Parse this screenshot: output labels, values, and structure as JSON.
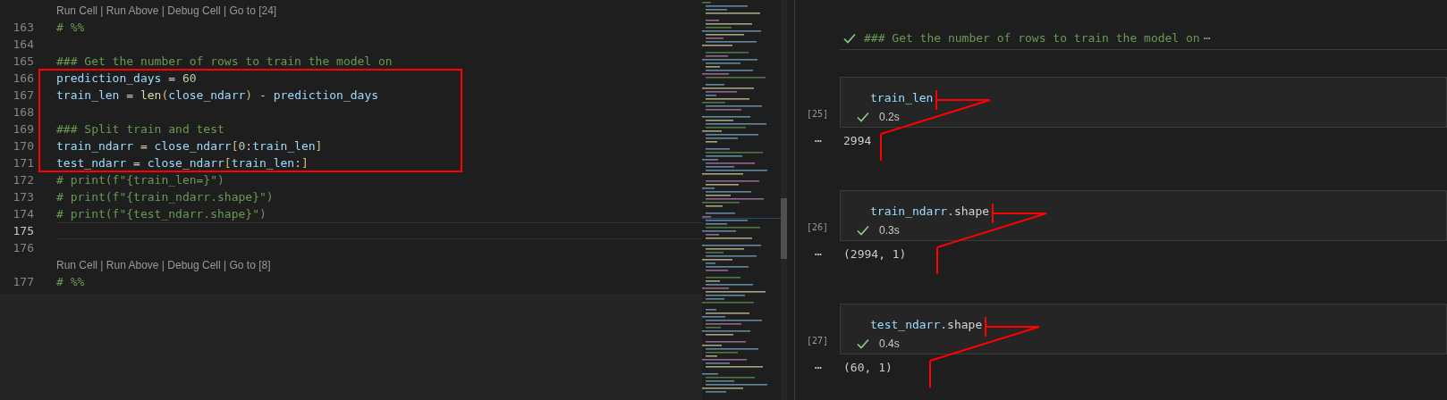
{
  "editor": {
    "lines": [
      {
        "kind": "codelens",
        "text": "Run Cell | Run Above | Debug Cell | Go to [24]"
      },
      {
        "kind": "code",
        "number": "163",
        "current": false,
        "tokens": [
          {
            "text": "# %%",
            "kind": "comment"
          }
        ]
      },
      {
        "kind": "code",
        "number": "164",
        "current": false
      },
      {
        "kind": "code",
        "number": "165",
        "current": false,
        "tokens": [
          {
            "text": "### Get the number of rows to train the model on",
            "kind": "comment"
          }
        ]
      },
      {
        "kind": "annotated",
        "lines": [
          {
            "kind": "code",
            "number": "166",
            "current": false,
            "tokens": [
              {
                "text": "prediction_days",
                "kind": "name"
              },
              {
                "text": " = ",
                "kind": "operator"
              },
              {
                "text": "60",
                "kind": "number"
              }
            ]
          },
          {
            "kind": "code",
            "number": "167",
            "current": false,
            "tokens": [
              {
                "text": "train_len",
                "kind": "name"
              },
              {
                "text": " = ",
                "kind": "operator"
              },
              {
                "text": "len",
                "kind": "function"
              },
              {
                "text": "(",
                "kind": "bracket"
              },
              {
                "text": "close_ndarr",
                "kind": "name"
              },
              {
                "text": ")",
                "kind": "bracket"
              },
              {
                "text": " - ",
                "kind": "operator"
              },
              {
                "text": "prediction_days",
                "kind": "name"
              }
            ]
          },
          {
            "kind": "code",
            "number": "168",
            "current": false
          },
          {
            "kind": "code",
            "number": "169",
            "current": false,
            "tokens": [
              {
                "text": "### Split train and test",
                "kind": "comment"
              }
            ]
          },
          {
            "kind": "code",
            "number": "170",
            "current": false,
            "tokens": [
              {
                "text": "train_ndarr",
                "kind": "name"
              },
              {
                "text": " = ",
                "kind": "operator"
              },
              {
                "text": "close_ndarr",
                "kind": "name"
              },
              {
                "text": "[",
                "kind": "bracket"
              },
              {
                "text": "0",
                "kind": "number"
              },
              {
                "text": ":",
                "kind": "operator"
              },
              {
                "text": "train_len",
                "kind": "name"
              },
              {
                "text": "]",
                "kind": "bracket"
              }
            ]
          },
          {
            "kind": "code",
            "number": "171",
            "current": false,
            "tokens": [
              {
                "text": "test_ndarr",
                "kind": "name"
              },
              {
                "text": " = ",
                "kind": "operator"
              },
              {
                "text": "close_ndarr",
                "kind": "name"
              },
              {
                "text": "[",
                "kind": "bracket"
              },
              {
                "text": "train_len",
                "kind": "name"
              },
              {
                "text": ":",
                "kind": "operator"
              },
              {
                "text": "]",
                "kind": "bracket"
              }
            ]
          }
        ]
      },
      {
        "kind": "code",
        "number": "172",
        "current": false,
        "tokens": [
          {
            "text": "# print(f\"{train_len=}\")",
            "kind": "comment"
          }
        ]
      },
      {
        "kind": "code",
        "number": "173",
        "current": false,
        "tokens": [
          {
            "text": "# print(f\"{train_ndarr.shape}\")",
            "kind": "comment"
          }
        ]
      },
      {
        "kind": "code",
        "number": "174",
        "current": false,
        "tokens": [
          {
            "text": "# print(f\"{test_ndarr.shape}\")",
            "kind": "comment"
          }
        ]
      },
      {
        "kind": "code",
        "number": "175",
        "current": true
      },
      {
        "kind": "code",
        "number": "176",
        "current": false
      },
      {
        "kind": "codelens",
        "text": "Run Cell | Run Above | Debug Cell | Go to [8]"
      },
      {
        "kind": "code",
        "number": "177",
        "current": false,
        "tokens": [
          {
            "text": "# %%",
            "kind": "comment"
          }
        ]
      }
    ]
  },
  "notebook": {
    "cells": [
      {
        "kind": "markdown",
        "text": "### Get the number of rows to train the model on",
        "more": "⋯",
        "succeeded": true
      },
      {
        "kind": "code",
        "count": "[25]",
        "tokens": [
          {
            "text": "train_len",
            "kind": "name"
          }
        ],
        "succeeded": true,
        "time": "0.2s",
        "output_marker": "⋯",
        "output": "2994"
      },
      {
        "kind": "code",
        "count": "[26]",
        "tokens": [
          {
            "text": "train_ndarr",
            "kind": "name"
          },
          {
            "text": ".shape",
            "kind": "operator"
          }
        ],
        "succeeded": true,
        "time": "0.3s",
        "output_marker": "⋯",
        "output": "(2994, 1)"
      },
      {
        "kind": "code",
        "count": "[27]",
        "tokens": [
          {
            "text": "test_ndarr",
            "kind": "name"
          },
          {
            "text": ".shape",
            "kind": "operator"
          }
        ],
        "succeeded": true,
        "time": "0.4s",
        "output_marker": "⋯",
        "output": "(60, 1)"
      }
    ]
  }
}
